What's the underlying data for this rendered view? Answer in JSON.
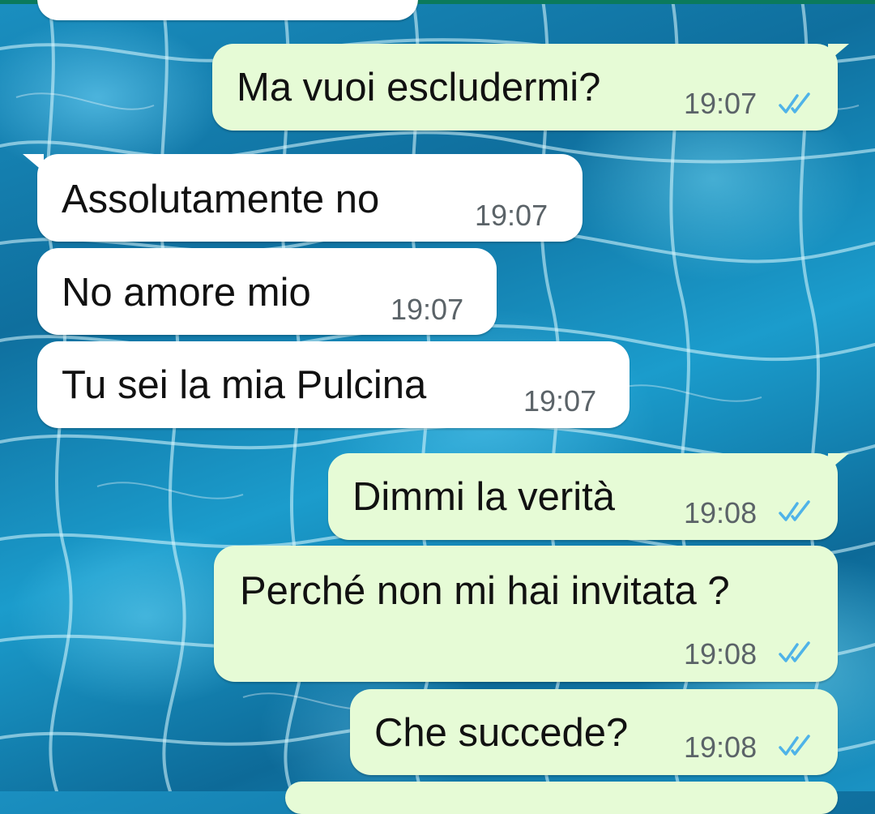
{
  "colors": {
    "outgoing_bubble": "#e6fbd6",
    "incoming_bubble": "#ffffff",
    "read_ticks": "#4fb3e8",
    "timestamp": "#5b6368",
    "top_bar": "#0b7a5c"
  },
  "icons": {
    "read_receipt": "double-check-icon"
  },
  "messages": [
    {
      "direction": "outgoing",
      "text": "Ma vuoi escludermi?",
      "time": "19:07",
      "status": "read"
    },
    {
      "direction": "incoming",
      "text": "Assolutamente no",
      "time": "19:07"
    },
    {
      "direction": "incoming",
      "text": "No amore mio",
      "time": "19:07"
    },
    {
      "direction": "incoming",
      "text": "Tu sei la mia Pulcina",
      "time": "19:07"
    },
    {
      "direction": "outgoing",
      "text": "Dimmi la verità",
      "time": "19:08",
      "status": "read"
    },
    {
      "direction": "outgoing",
      "text": "Perché non mi hai invitata ?",
      "time": "19:08",
      "status": "read"
    },
    {
      "direction": "outgoing",
      "text": "Che succede?",
      "time": "19:08",
      "status": "read"
    }
  ]
}
